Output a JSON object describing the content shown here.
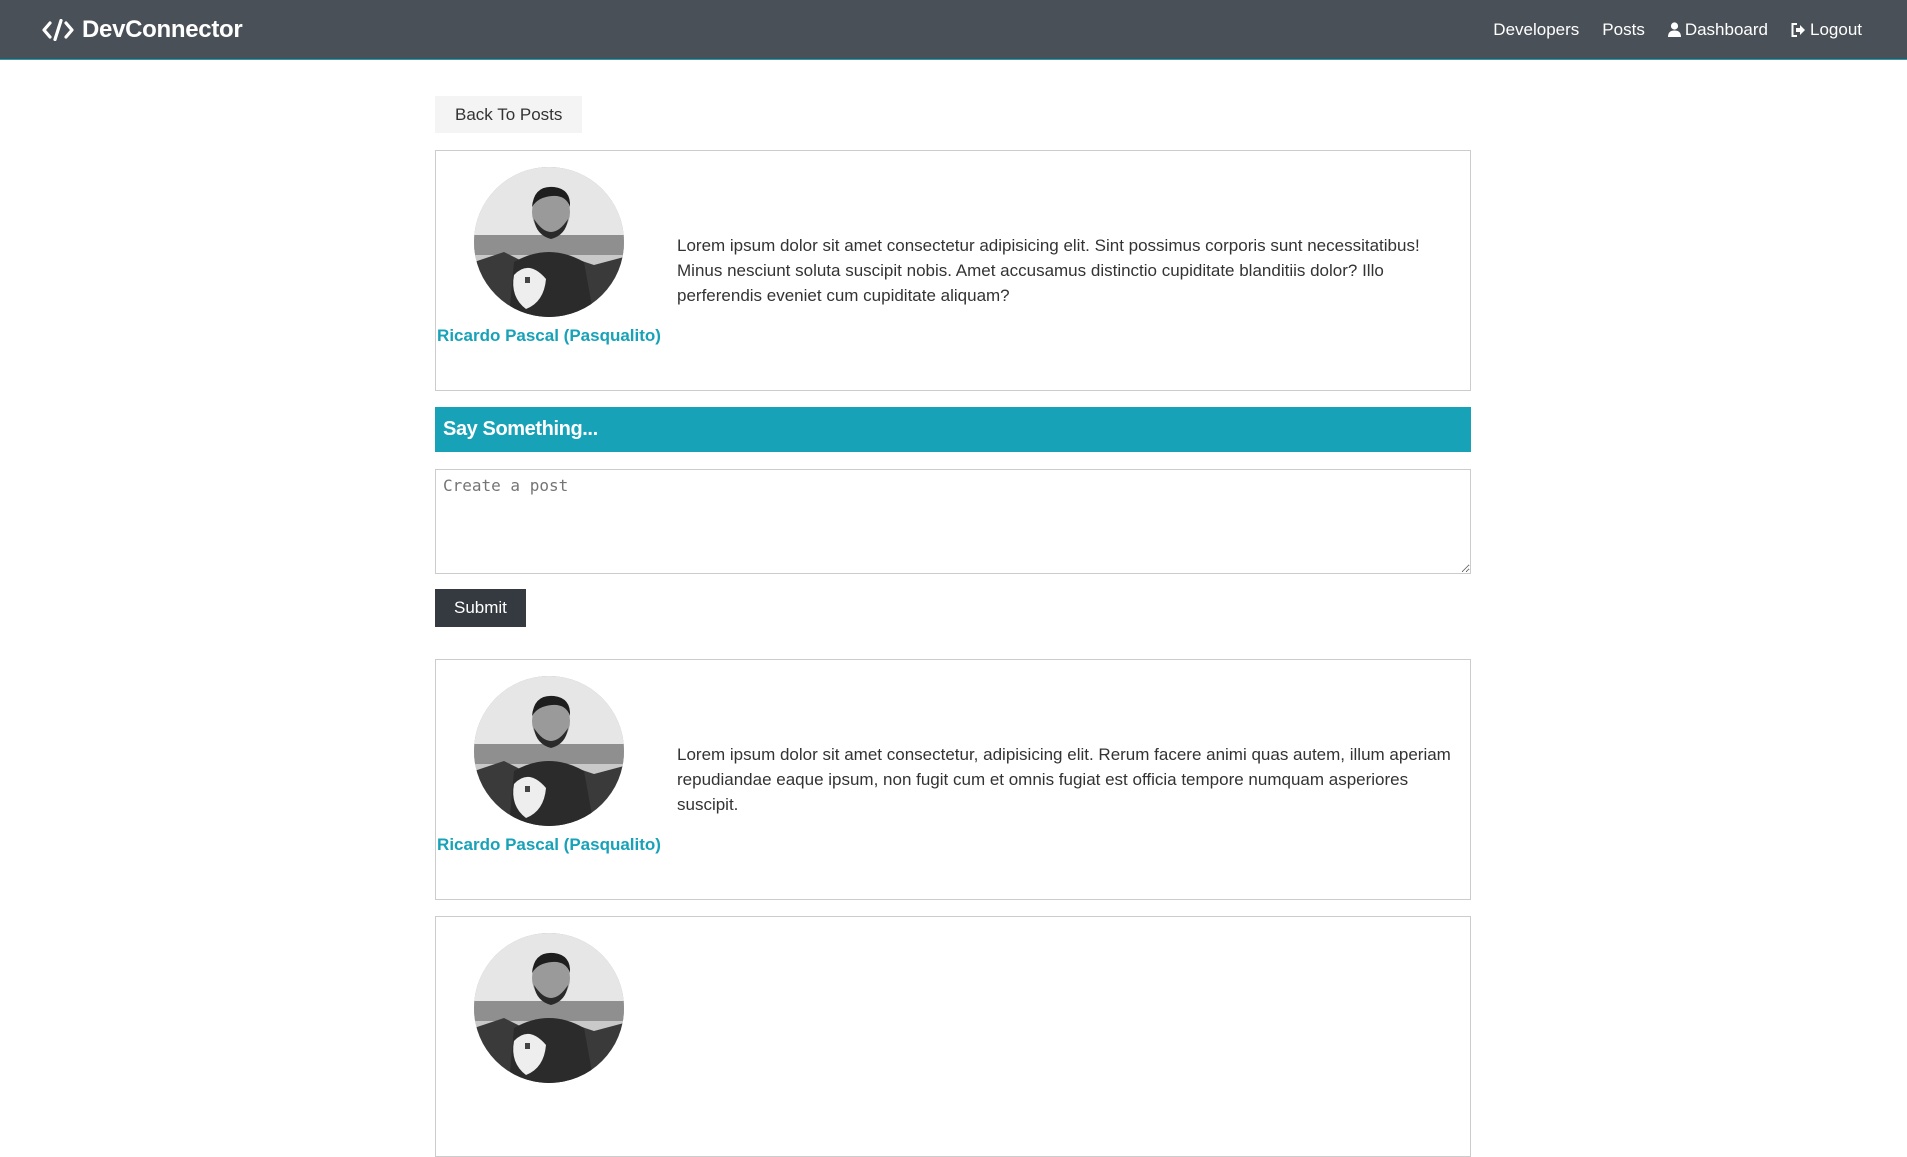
{
  "navbar": {
    "brand_text": "DevConnector",
    "brand_icon": "code-icon",
    "links": [
      {
        "label": "Developers"
      },
      {
        "label": "Posts"
      },
      {
        "label": "Dashboard",
        "icon": "user-icon"
      },
      {
        "label": "Logout",
        "icon": "sign-out-icon"
      }
    ]
  },
  "back_button_label": "Back To Posts",
  "post": {
    "author_name": "Ricardo Pascal (Pasqualito)",
    "text": "Lorem ipsum dolor sit amet consectetur adipisicing elit. Sint possimus corporis sunt necessitatibus! Minus nesciunt soluta suscipit nobis. Amet accusamus distinctio cupiditate blanditiis dolor? Illo perferendis eveniet cum cupiditate aliquam?"
  },
  "comment_form": {
    "heading": "Say Something...",
    "placeholder": "Create a post",
    "value": "",
    "submit_label": "Submit"
  },
  "comments": [
    {
      "author_name": "Ricardo Pascal (Pasqualito)",
      "text": "Lorem ipsum dolor sit amet consectetur, adipisicing elit. Rerum facere animi quas autem, illum aperiam repudiandae eaque ipsum, non fugit cum et omnis fugiat est officia tempore numquam asperiores suscipit."
    }
  ],
  "colors": {
    "navbar_bg": "#495057",
    "primary": "#17a2b8",
    "dark": "#343a40",
    "light": "#f4f4f4"
  }
}
